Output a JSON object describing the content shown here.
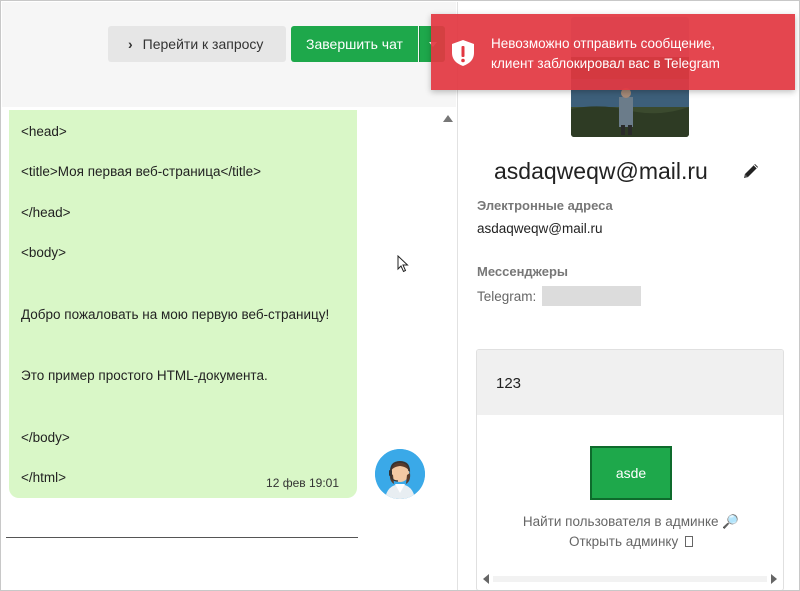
{
  "toolbar": {
    "goto_request_label": "Перейти к запросу",
    "finish_chat_label": "Завершить чат"
  },
  "message": {
    "lines": [
      "<head>",
      "<title>Моя первая веб-страница</title>",
      "</head>",
      "<body>",
      "Добро пожаловать на мою первую веб-страницу!",
      "Это пример простого HTML-документа.",
      "</body>",
      "</html>"
    ],
    "timestamp": "12 фев 19:01",
    "bubble_color": "#d9f7c7"
  },
  "contact": {
    "name": "asdaqweqw@mail.ru",
    "emails_label": "Электронные адреса",
    "email": "asdaqweqw@mail.ru",
    "messengers_label": "Мессенджеры",
    "telegram_label": "Telegram:"
  },
  "widget": {
    "title": "123",
    "button_label": "asde",
    "find_user_link": "Найти пользователя в админке 🔎",
    "open_admin_link": "Открыть админку"
  },
  "toast": {
    "message": "Невозможно отправить сообщение, клиент заблокировал вас в Telegram",
    "line1": "Невозможно отправить сообщение,",
    "line2": "клиент заблокировал вас в Telegram",
    "color": "#e23842"
  },
  "colors": {
    "accent_green": "#1ea84b",
    "error_red": "#e23842"
  },
  "icons": [
    "chevron-right-icon",
    "caret-down-icon",
    "pencil-icon",
    "shield-alert-icon",
    "operator-avatar",
    "mouse-cursor-icon",
    "search-icon"
  ]
}
